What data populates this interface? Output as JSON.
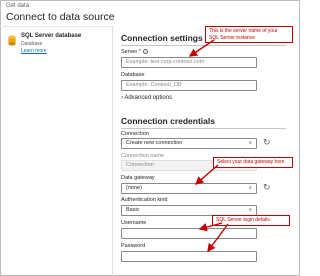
{
  "window": {
    "title": "Get data"
  },
  "page": {
    "title": "Connect to data source"
  },
  "source": {
    "name": "SQL Server database",
    "subtitle": "Database",
    "learn_more": "Learn more"
  },
  "connection_settings": {
    "heading": "Connection settings",
    "server": {
      "label": "Server",
      "required_mark": "*",
      "placeholder": "Example: test.corp.contoso.com"
    },
    "database": {
      "label": "Database",
      "placeholder": "Example: Contoso_DB"
    },
    "advanced": "Advanced options"
  },
  "connection_credentials": {
    "heading": "Connection credentials",
    "connection": {
      "label": "Connection",
      "value": "Create new connection"
    },
    "connection_name": {
      "label": "Connection name",
      "value": "Connection"
    },
    "data_gateway": {
      "label": "Data gateway",
      "value": "(none)"
    },
    "auth_kind": {
      "label": "Authentication kind",
      "value": "Basic"
    },
    "username": {
      "label": "Username",
      "value": ""
    },
    "password": {
      "label": "Password",
      "value": ""
    }
  },
  "annotations": {
    "server_note": "This is the server name of your SQL Server instance",
    "gateway_note": "Select your data gateway here",
    "login_note": "SQL Server login details",
    "color": "#c00000"
  },
  "icons": {
    "database": "database-icon",
    "info": "info-icon",
    "chevron": "chevron-down-icon",
    "refresh": "refresh-icon",
    "expand": "chevron-right-icon"
  }
}
